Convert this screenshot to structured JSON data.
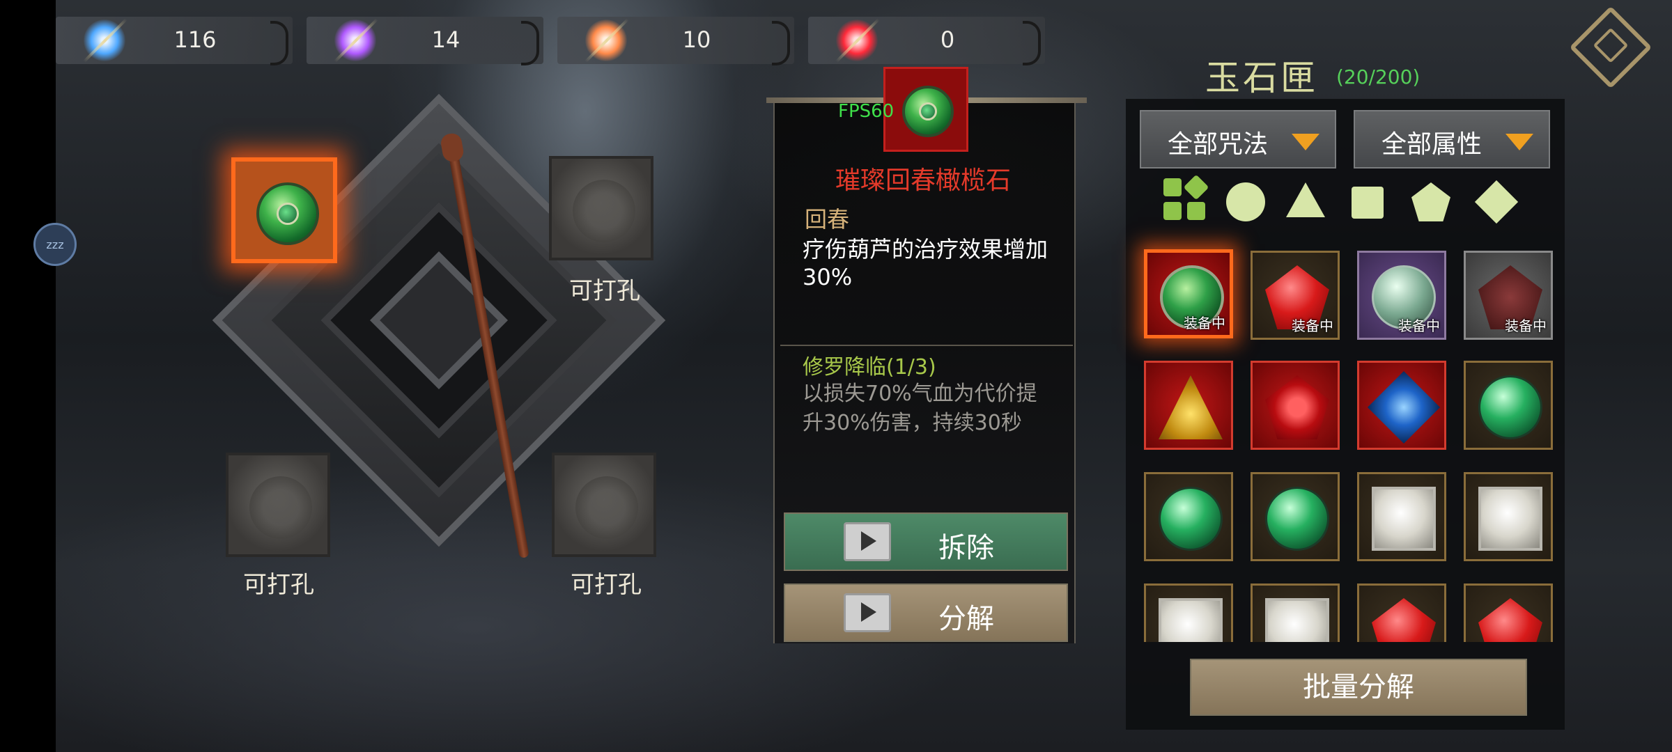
{
  "currencies": [
    {
      "name": "blue-crystal",
      "value": "116",
      "color": "#4fa8ff"
    },
    {
      "name": "purple-crystal",
      "value": "14",
      "color": "#b05aff"
    },
    {
      "name": "orange-crystal",
      "value": "10",
      "color": "#ff8a4a"
    },
    {
      "name": "red-crystal",
      "value": "0",
      "color": "#ff2a3a"
    }
  ],
  "sleep_badge": "zzz",
  "sockets": {
    "top_right_label": "可打孔",
    "bottom_left_label": "可打孔",
    "bottom_right_label": "可打孔"
  },
  "detail": {
    "fps": "FPS60",
    "name": "璀璨回春橄榄石",
    "subtitle": "回春",
    "description": "疗伤葫芦的治疗效果增加30%",
    "set_name": "修罗降临(1/3)",
    "set_description": "以损失70%气血为代价提升30%伤害，持续30秒",
    "remove_label": "拆除",
    "decompose_label": "分解"
  },
  "inventory": {
    "title": "玉石匣",
    "count": "(20/200)",
    "filter_spell": "全部咒法",
    "filter_attr": "全部属性",
    "equipped_tag": "装备中",
    "batch_label": "批量分解"
  },
  "colors": {
    "accent_orange": "#ff6a1c",
    "title_gold": "#d9dba0",
    "count_green": "#56d05a",
    "name_red": "#e43a2a"
  }
}
